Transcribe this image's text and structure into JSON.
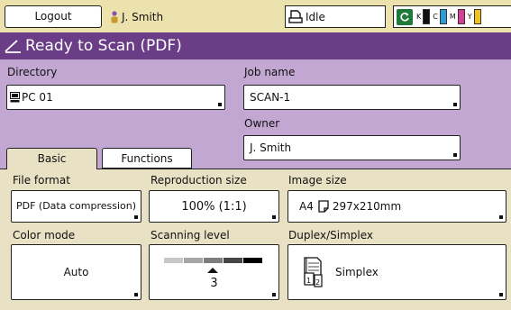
{
  "header": {
    "logout_label": "Logout",
    "user_name": "J. Smith",
    "status": "Idle",
    "ink_levels": [
      {
        "letter": "K",
        "color": "#111111",
        "level": 1.0
      },
      {
        "letter": "C",
        "color": "#2b9cd8",
        "level": 1.0
      },
      {
        "letter": "M",
        "color": "#d63f95",
        "level": 1.0
      },
      {
        "letter": "Y",
        "color": "#f2c21b",
        "level": 1.0
      }
    ]
  },
  "title": "Ready to Scan (PDF)",
  "colors": {
    "title_bar": "#6a3d86",
    "upper_panel": "#c3a7d3",
    "lower_panel": "#e9e1c4",
    "top_bar": "#ece2ad"
  },
  "directory": {
    "label": "Directory",
    "value": "PC 01"
  },
  "job_name": {
    "label": "Job name",
    "value": "SCAN-1"
  },
  "owner": {
    "label": "Owner",
    "value": "J. Smith"
  },
  "tabs": [
    {
      "label": "Basic",
      "selected": true
    },
    {
      "label": "Functions",
      "selected": false
    }
  ],
  "settings": {
    "file_format": {
      "label": "File format",
      "value": "PDF (Data compression)"
    },
    "reproduction_size": {
      "label": "Reproduction size",
      "value": "100% (1:1)"
    },
    "image_size": {
      "label": "Image size",
      "paper": "A4",
      "dimensions": "297x210mm"
    },
    "color_mode": {
      "label": "Color mode",
      "value": "Auto"
    },
    "scanning_level": {
      "label": "Scanning level",
      "value": "3"
    },
    "duplex_simplex": {
      "label": "Duplex/Simplex",
      "value": "Simplex"
    }
  }
}
